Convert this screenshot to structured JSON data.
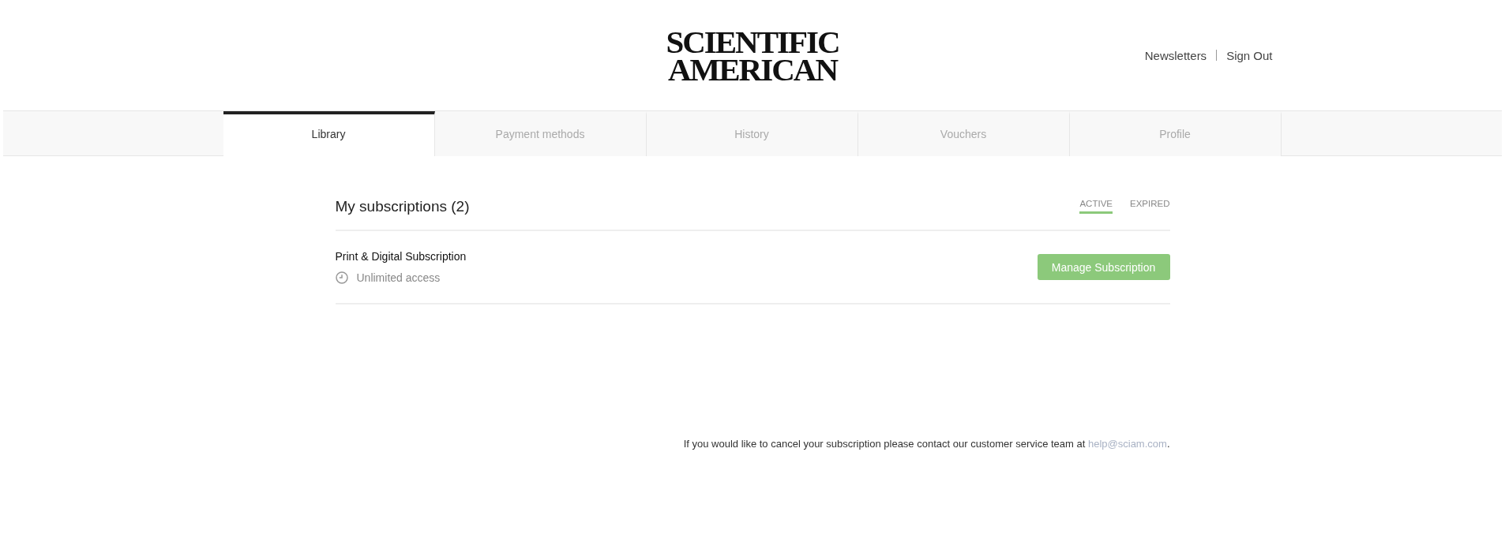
{
  "header": {
    "logo": {
      "lines": [
        "SCIENTIFIC",
        "AMERICAN"
      ]
    },
    "links": [
      {
        "label": "Newsletters"
      },
      {
        "label": "Sign Out"
      }
    ]
  },
  "tabs": [
    {
      "label": "Library",
      "selected": true
    },
    {
      "label": "Payment methods",
      "selected": false
    },
    {
      "label": "History",
      "selected": false
    },
    {
      "label": "Vouchers",
      "selected": false
    },
    {
      "label": "Profile",
      "selected": false
    }
  ],
  "subscriptions": {
    "title": "My subscriptions (2)",
    "filters": [
      {
        "label": "ACTIVE",
        "selected": true
      },
      {
        "label": "EXPIRED",
        "selected": false
      }
    ],
    "items": [
      {
        "name": "Print & Digital Subscription",
        "access": "Unlimited access",
        "action": "Manage Subscription"
      }
    ]
  },
  "footer": {
    "text": "If you would like to cancel your subscription please contact our customer service team at ",
    "link": "help@sciam.com",
    "end": "."
  }
}
